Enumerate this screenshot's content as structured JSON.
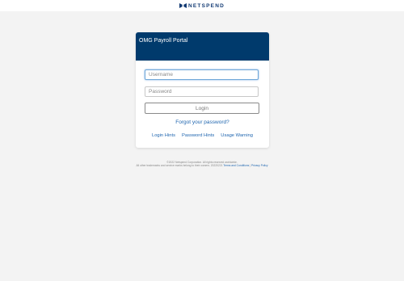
{
  "header": {
    "brand": "NETSPEND",
    "logo_icon": "netspend-bowtie-logo",
    "brand_color": "#123a73"
  },
  "login": {
    "title": "OMG Payroll Portal",
    "username_placeholder": "Username",
    "password_placeholder": "Password",
    "login_label": "Login",
    "forgot_label": "Forgot your password?",
    "links": [
      "Login Hints",
      "Password Hints",
      "Usage Warning"
    ],
    "header_color": "#003a6c",
    "link_color": "#2167b0"
  },
  "footer": {
    "copyright": "©2022 Netspend Corporation. All rights reserved worldwide.",
    "trademark": "All other trademarks and service marks belong to their owners. 20220221",
    "terms_label": "Terms and Conditions",
    "separator": "|",
    "privacy_label": "Privacy Policy"
  }
}
